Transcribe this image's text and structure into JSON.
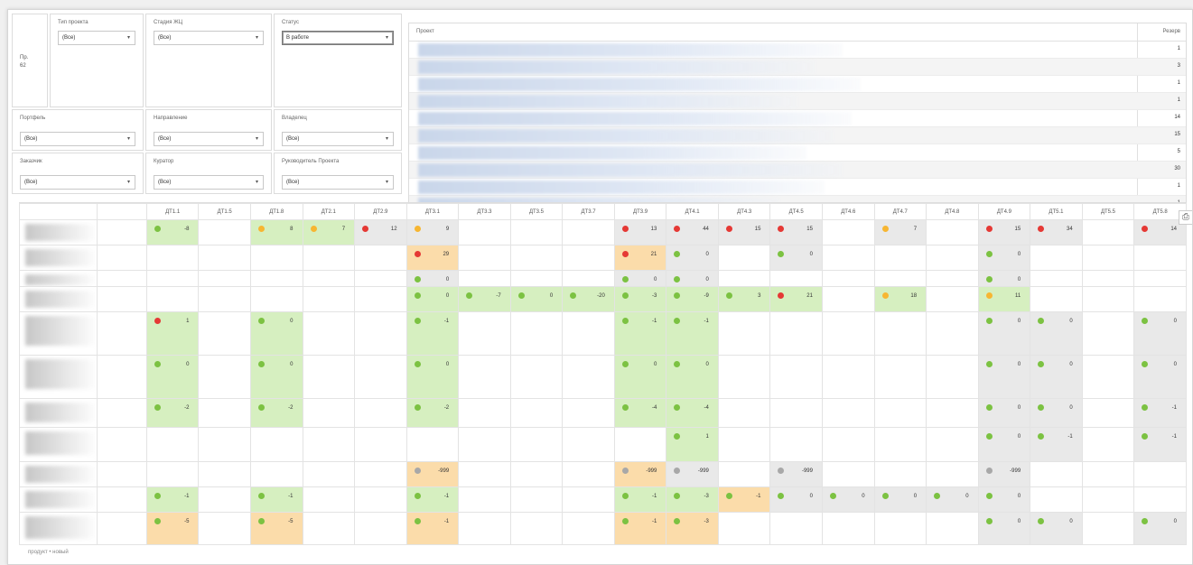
{
  "colors": {
    "green": "#7cc242",
    "orange": "#f7b632",
    "red": "#e53935",
    "gray": "#a8a8a8",
    "bg_green": "#d6efc0",
    "bg_orange": "#fbdcaa",
    "bg_gray": "#e9e9e9"
  },
  "filters": {
    "count_label": "Пр.",
    "count_value": "62",
    "project_type": {
      "label": "Тип проекта",
      "value": "(Все)"
    },
    "lifecycle": {
      "label": "Стадия ЖЦ",
      "value": "(Все)"
    },
    "status": {
      "label": "Статус",
      "value": "В работе"
    },
    "portfolio": {
      "label": "Портфель",
      "value": "(Все)"
    },
    "direction": {
      "label": "Направление",
      "value": "(Все)"
    },
    "owner": {
      "label": "Владелец",
      "value": "(Все)"
    },
    "customer": {
      "label": "Заказчик",
      "value": "(Все)"
    },
    "curator": {
      "label": "Куратор",
      "value": "(Все)"
    },
    "manager": {
      "label": "Руководитель Проекта",
      "value": "(Все)"
    },
    "arrow": "▾"
  },
  "projects": {
    "header": "Проект",
    "reserve_header": "Резерв",
    "rows": [
      {
        "reserve": "1"
      },
      {
        "reserve": "3"
      },
      {
        "reserve": "1"
      },
      {
        "reserve": "1"
      },
      {
        "reserve": "14"
      },
      {
        "reserve": "15"
      },
      {
        "reserve": "5"
      },
      {
        "reserve": "30"
      },
      {
        "reserve": "1"
      },
      {
        "reserve": "1"
      }
    ]
  },
  "grid": {
    "columns": [
      "ДТ1.1",
      "ДТ1.5",
      "ДТ1.8",
      "ДТ2.1",
      "ДТ2.9",
      "ДТ3.1",
      "ДТ3.3",
      "ДТ3.5",
      "ДТ3.7",
      "ДТ3.9",
      "ДТ4.1",
      "ДТ4.3",
      "ДТ4.5",
      "ДТ4.6",
      "ДТ4.7",
      "ДТ4.8",
      "ДТ4.9",
      "ДТ5.1",
      "ДТ5.5",
      "ДТ5.8"
    ],
    "rows": [
      {
        "h": 28,
        "cells": [
          [
            "g",
            "bg_green",
            "-8"
          ],
          null,
          [
            "o",
            "bg_green",
            "8"
          ],
          [
            "o",
            "bg_green",
            "7"
          ],
          [
            "r",
            "bg_gray",
            "12"
          ],
          [
            "o",
            "bg_gray",
            "9"
          ],
          null,
          null,
          null,
          [
            "r",
            "bg_gray",
            "13"
          ],
          [
            "r",
            "bg_gray",
            "44"
          ],
          [
            "r",
            "bg_gray",
            "15"
          ],
          [
            "r",
            "bg_gray",
            "15"
          ],
          null,
          [
            "o",
            "bg_gray",
            "7"
          ],
          null,
          [
            "r",
            "bg_gray",
            "15"
          ],
          [
            "r",
            "bg_gray",
            "34"
          ],
          null,
          [
            "r",
            "bg_gray",
            "14"
          ]
        ]
      },
      {
        "h": 28,
        "cells": [
          null,
          null,
          null,
          null,
          null,
          [
            "r",
            "bg_orange",
            "29"
          ],
          null,
          null,
          null,
          [
            "r",
            "bg_orange",
            "21"
          ],
          [
            "g",
            "bg_gray",
            "0"
          ],
          null,
          [
            "g",
            "bg_gray",
            "0"
          ],
          null,
          null,
          null,
          [
            "g",
            "bg_gray",
            "0"
          ],
          null,
          null,
          null
        ]
      },
      {
        "h": 18,
        "cells": [
          null,
          null,
          null,
          null,
          null,
          [
            "g",
            "bg_gray",
            "0"
          ],
          null,
          null,
          null,
          [
            "g",
            "bg_gray",
            "0"
          ],
          [
            "g",
            "bg_gray",
            "0"
          ],
          null,
          null,
          null,
          null,
          null,
          [
            "g",
            "bg_gray",
            "0"
          ],
          null,
          null,
          null
        ]
      },
      {
        "h": 28,
        "cells": [
          null,
          null,
          null,
          null,
          null,
          [
            "g",
            "bg_green",
            "0"
          ],
          [
            "g",
            "bg_green",
            "-7"
          ],
          [
            "g",
            "bg_green",
            "0"
          ],
          [
            "g",
            "bg_green",
            "-20"
          ],
          [
            "g",
            "bg_green",
            "-3"
          ],
          [
            "g",
            "bg_green",
            "-9"
          ],
          [
            "g",
            "bg_green",
            "3"
          ],
          [
            "r",
            "bg_green",
            "21"
          ],
          null,
          [
            "o",
            "bg_green",
            "18"
          ],
          null,
          [
            "o",
            "bg_green",
            "11"
          ],
          null,
          null,
          null
        ]
      },
      {
        "h": 48,
        "cells": [
          [
            "r",
            "bg_green",
            "1"
          ],
          null,
          [
            "g",
            "bg_green",
            "0"
          ],
          null,
          null,
          [
            "g",
            "bg_green",
            "-1"
          ],
          null,
          null,
          null,
          [
            "g",
            "bg_green",
            "-1"
          ],
          [
            "g",
            "bg_green",
            "-1"
          ],
          null,
          null,
          null,
          null,
          null,
          [
            "g",
            "bg_gray",
            "0"
          ],
          [
            "g",
            "bg_gray",
            "0"
          ],
          null,
          [
            "g",
            "bg_gray",
            "0"
          ]
        ]
      },
      {
        "h": 48,
        "cells": [
          [
            "g",
            "bg_green",
            "0"
          ],
          null,
          [
            "g",
            "bg_green",
            "0"
          ],
          null,
          null,
          [
            "g",
            "bg_green",
            "0"
          ],
          null,
          null,
          null,
          [
            "g",
            "bg_green",
            "0"
          ],
          [
            "g",
            "bg_green",
            "0"
          ],
          null,
          null,
          null,
          null,
          null,
          [
            "g",
            "bg_gray",
            "0"
          ],
          [
            "g",
            "bg_gray",
            "0"
          ],
          null,
          [
            "g",
            "bg_gray",
            "0"
          ]
        ]
      },
      {
        "h": 32,
        "cells": [
          [
            "g",
            "bg_green",
            "-2"
          ],
          null,
          [
            "g",
            "bg_green",
            "-2"
          ],
          null,
          null,
          [
            "g",
            "bg_green",
            "-2"
          ],
          null,
          null,
          null,
          [
            "g",
            "bg_green",
            "-4"
          ],
          [
            "g",
            "bg_green",
            "-4"
          ],
          null,
          null,
          null,
          null,
          null,
          [
            "g",
            "bg_gray",
            "0"
          ],
          [
            "g",
            "bg_gray",
            "0"
          ],
          null,
          [
            "g",
            "bg_gray",
            "-1"
          ]
        ]
      },
      {
        "h": 38,
        "cells": [
          null,
          null,
          null,
          null,
          null,
          null,
          null,
          null,
          null,
          null,
          [
            "g",
            "bg_green",
            "1"
          ],
          null,
          null,
          null,
          null,
          null,
          [
            "g",
            "bg_gray",
            "0"
          ],
          [
            "g",
            "bg_gray",
            "-1"
          ],
          null,
          [
            "g",
            "bg_gray",
            "-1"
          ]
        ]
      },
      {
        "h": 28,
        "cells": [
          null,
          null,
          null,
          null,
          null,
          [
            "a",
            "bg_orange",
            "-999"
          ],
          null,
          null,
          null,
          [
            "a",
            "bg_orange",
            "-999"
          ],
          [
            "a",
            "bg_gray",
            "-999"
          ],
          null,
          [
            "a",
            "bg_gray",
            "-999"
          ],
          null,
          null,
          null,
          [
            "a",
            "bg_gray",
            "-999"
          ],
          null,
          null,
          null
        ]
      },
      {
        "h": 28,
        "cells": [
          [
            "g",
            "bg_green",
            "-1"
          ],
          null,
          [
            "g",
            "bg_green",
            "-1"
          ],
          null,
          null,
          [
            "g",
            "bg_green",
            "-1"
          ],
          null,
          null,
          null,
          [
            "g",
            "bg_green",
            "-1"
          ],
          [
            "g",
            "bg_green",
            "-3"
          ],
          [
            "g",
            "bg_orange",
            "-1"
          ],
          [
            "g",
            "bg_gray",
            "0"
          ],
          [
            "g",
            "bg_gray",
            "0"
          ],
          [
            "g",
            "bg_gray",
            "0"
          ],
          [
            "g",
            "bg_gray",
            "0"
          ],
          [
            "g",
            "bg_gray",
            "0"
          ],
          null,
          null,
          null
        ]
      },
      {
        "h": 36,
        "cells": [
          [
            "g",
            "bg_orange",
            "-5"
          ],
          null,
          [
            "g",
            "bg_orange",
            "-5"
          ],
          null,
          null,
          [
            "g",
            "bg_orange",
            "-1"
          ],
          null,
          null,
          null,
          [
            "g",
            "bg_orange",
            "-1"
          ],
          [
            "g",
            "bg_orange",
            "-3"
          ],
          null,
          null,
          null,
          null,
          null,
          [
            "g",
            "bg_gray",
            "0"
          ],
          [
            "g",
            "bg_gray",
            "0"
          ],
          null,
          [
            "g",
            "bg_gray",
            "0"
          ]
        ]
      }
    ],
    "footer": "продукт • новый"
  },
  "print_icon": "print-icon"
}
